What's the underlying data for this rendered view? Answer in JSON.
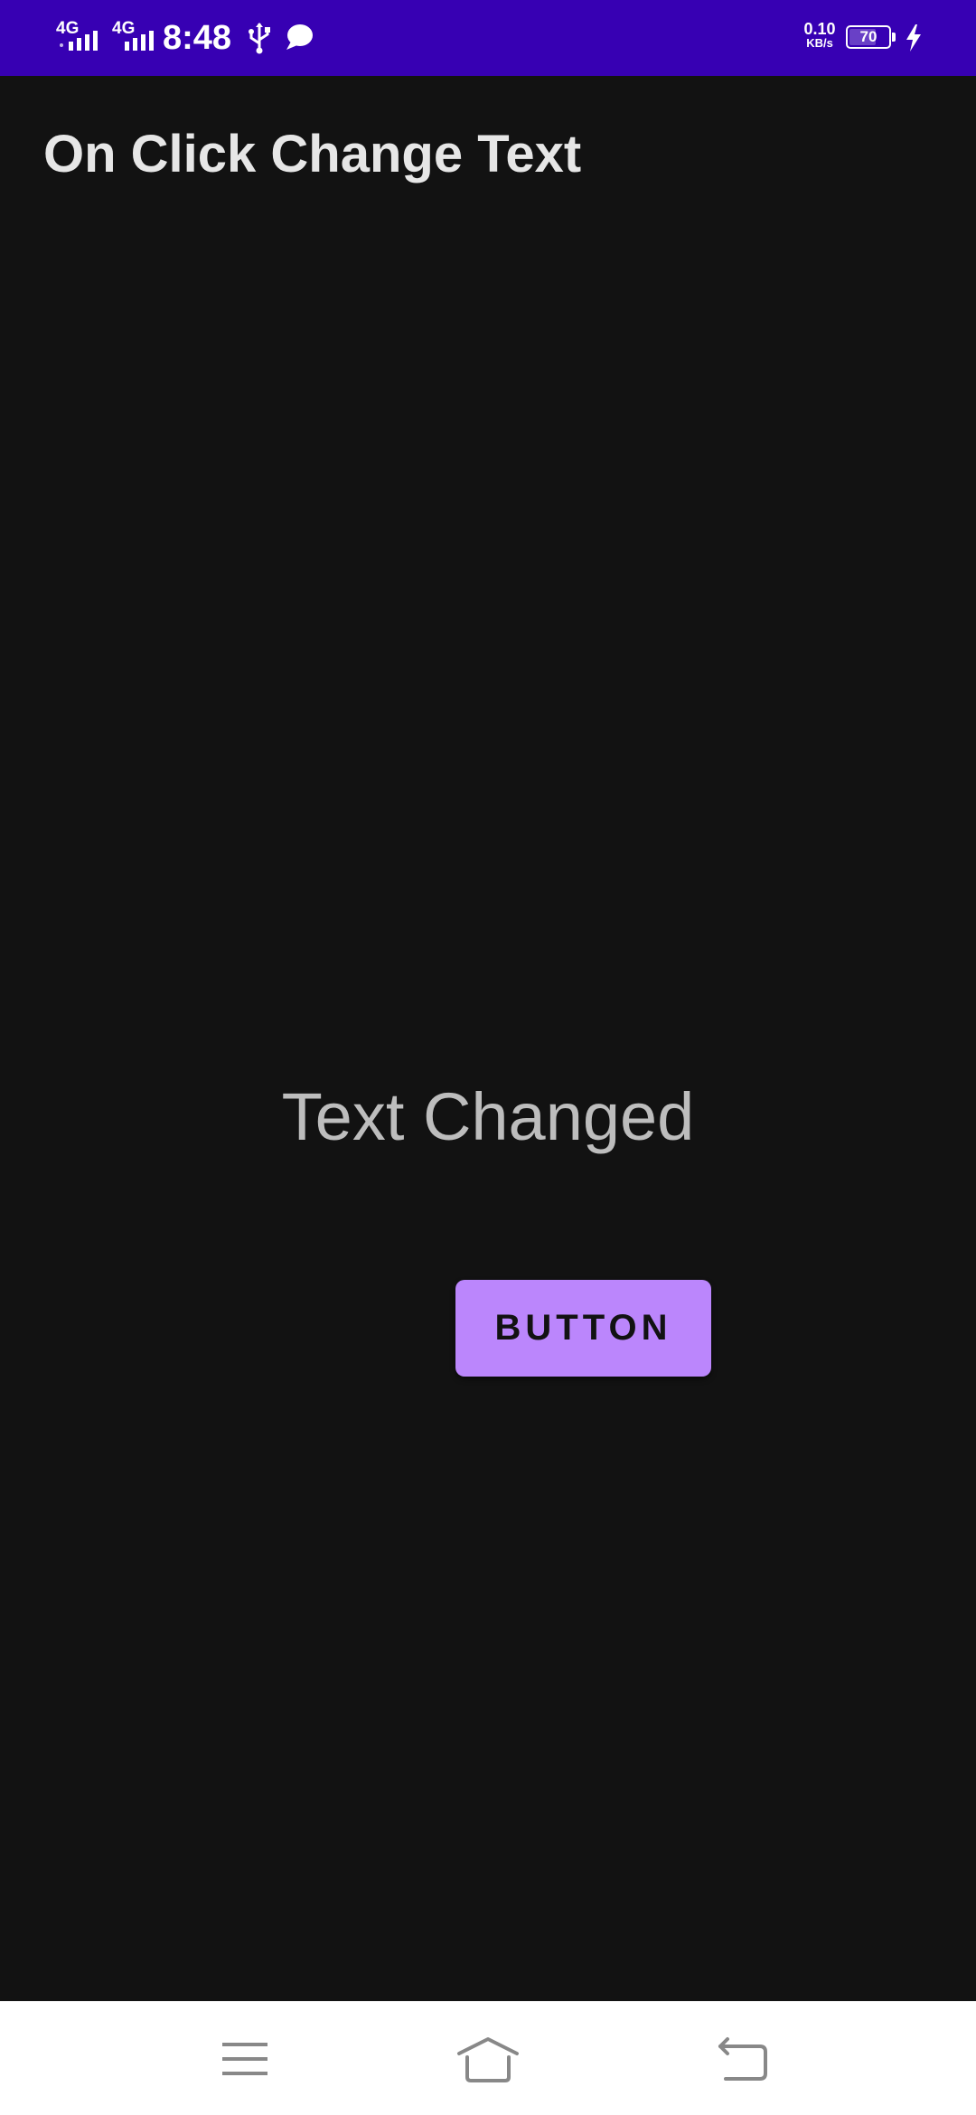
{
  "status_bar": {
    "network_1": "4G",
    "network_2": "4G",
    "time": "8:48",
    "speed_value": "0.10",
    "speed_unit": "KB/s",
    "battery_level": "70",
    "battery_fraction": 0.7,
    "icons": [
      "signal-icon",
      "usb-icon",
      "message-icon",
      "battery-icon",
      "charging-icon"
    ],
    "background_color": "#3700B3"
  },
  "app_bar": {
    "title": "On Click Change Text"
  },
  "main": {
    "message": "Text Changed",
    "button_label": "BUTTON",
    "accent_color": "#BB86FC",
    "background_color": "#121212"
  },
  "nav_bar": {
    "icons": [
      "menu-icon",
      "home-icon",
      "back-icon"
    ]
  }
}
